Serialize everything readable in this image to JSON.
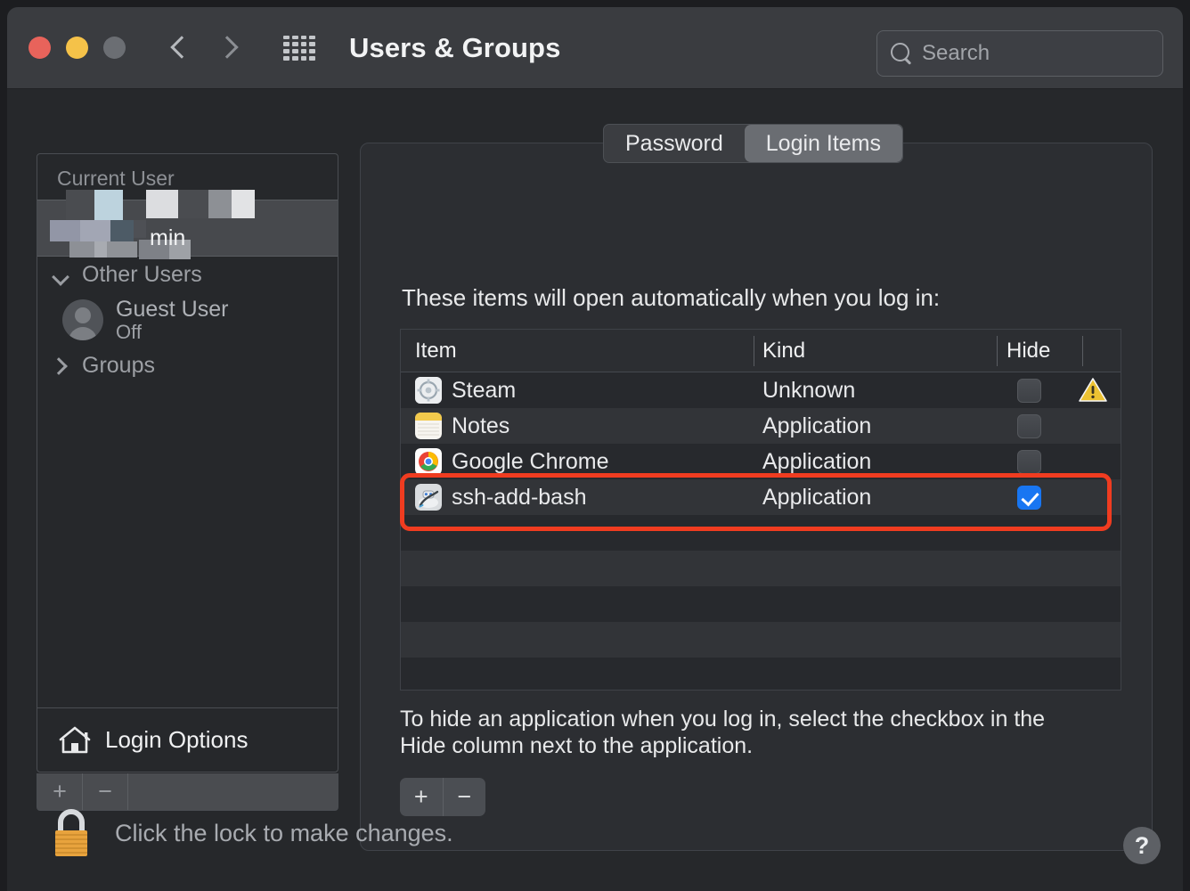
{
  "window": {
    "title": "Users & Groups",
    "traffic_lights": [
      "close-red",
      "minimize-yellow",
      "zoom-gray"
    ],
    "nav": {
      "back": "back-chevron",
      "forward": "forward-chevron"
    },
    "grid_button": "show-all-grid",
    "search": {
      "placeholder": "Search",
      "value": ""
    }
  },
  "sidebar": {
    "header": "Current User",
    "current_user": {
      "name_visible": "min",
      "redacted": true
    },
    "groups": [
      {
        "label": "Other Users",
        "expanded": true
      },
      {
        "label": "Groups",
        "expanded": false
      }
    ],
    "other_users": [
      {
        "name": "Guest User",
        "status": "Off"
      }
    ],
    "login_options": "Login Options",
    "toolbar": {
      "add": "+",
      "remove": "−"
    }
  },
  "main": {
    "tabs": [
      {
        "label": "Password",
        "active": false
      },
      {
        "label": "Login Items",
        "active": true
      }
    ],
    "intro": "These items will open automatically when you log in:",
    "table": {
      "columns": [
        "Item",
        "Kind",
        "Hide"
      ],
      "rows": [
        {
          "item": "Steam",
          "icon": "steam-icon",
          "kind": "Unknown",
          "hide": false,
          "warning": true
        },
        {
          "item": "Notes",
          "icon": "notes-icon",
          "kind": "Application",
          "hide": false,
          "warning": false
        },
        {
          "item": "Google Chrome",
          "icon": "chrome-icon",
          "kind": "Application",
          "hide": false,
          "warning": false
        },
        {
          "item": "ssh-add-bash",
          "icon": "automator-icon",
          "kind": "Application",
          "hide": true,
          "warning": false
        }
      ],
      "empty_rows": 6
    },
    "note": "To hide an application when you log in, select the checkbox in the Hide column next to the application.",
    "buttons": {
      "add": "+",
      "remove": "−"
    }
  },
  "footer": {
    "lock_text": "Click the lock to make changes.",
    "lock_state": "locked",
    "help": "?"
  },
  "highlight": {
    "target": "ssh-add-bash",
    "color": "#f03c20"
  }
}
